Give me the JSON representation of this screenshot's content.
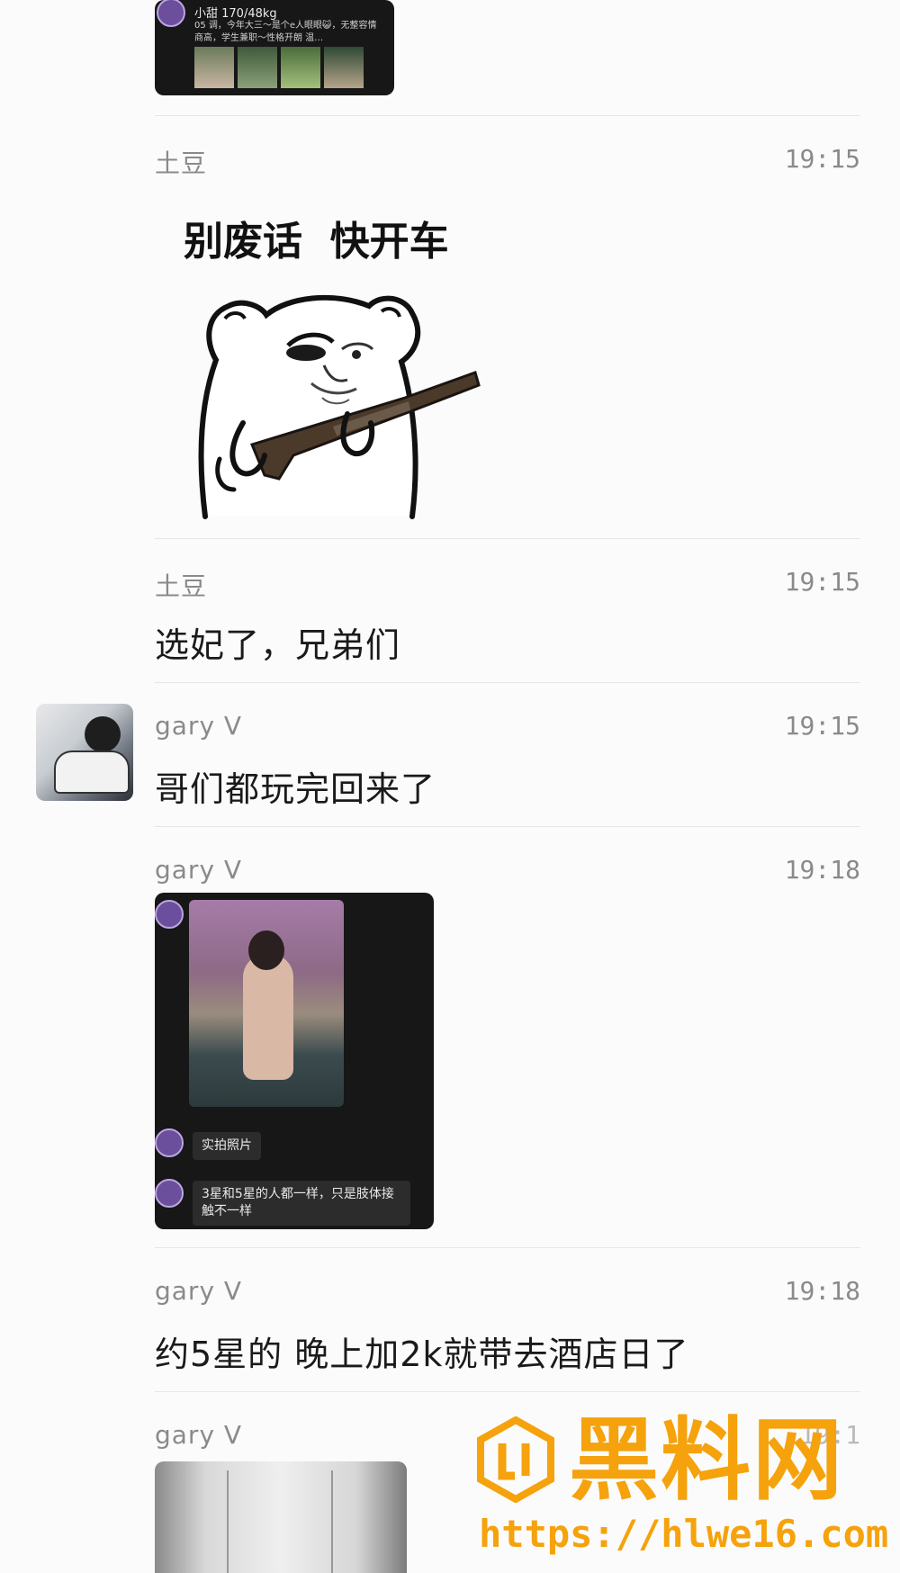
{
  "messages": [
    {
      "type": "shared-card",
      "card": {
        "title": "小甜 170/48kg",
        "text": "05 调，今年大三～是个e人眼眼😺，无整容情商高，学生兼职～性格开朗 温…"
      }
    },
    {
      "type": "sticker",
      "sender": "土豆",
      "time": "19:15",
      "sticker_caption": "别废话  快开车"
    },
    {
      "type": "text",
      "sender": "土豆",
      "time": "19:15",
      "text": "选妃了，兄弟们"
    },
    {
      "type": "text",
      "sender": "gary V",
      "time": "19:15",
      "text": "哥们都玩完回来了",
      "has_avatar": true
    },
    {
      "type": "forwarded-screenshot",
      "sender": "gary V",
      "time": "19:18",
      "bubbles": [
        "实拍照片",
        "3星和5星的人都一样，只是肢体接触不一样"
      ]
    },
    {
      "type": "text",
      "sender": "gary V",
      "time": "19:18",
      "text": "约5星的 晚上加2k就带去酒店日了"
    },
    {
      "type": "image",
      "sender": "gary V",
      "time": "19:1"
    }
  ],
  "watermark": {
    "brand": "黑料网",
    "url": "https://hlwe16.com",
    "color": "#f5a20c"
  },
  "icons": {
    "avatar": "user-avatar-photo",
    "mini_avatar": "purple-round-logo"
  }
}
